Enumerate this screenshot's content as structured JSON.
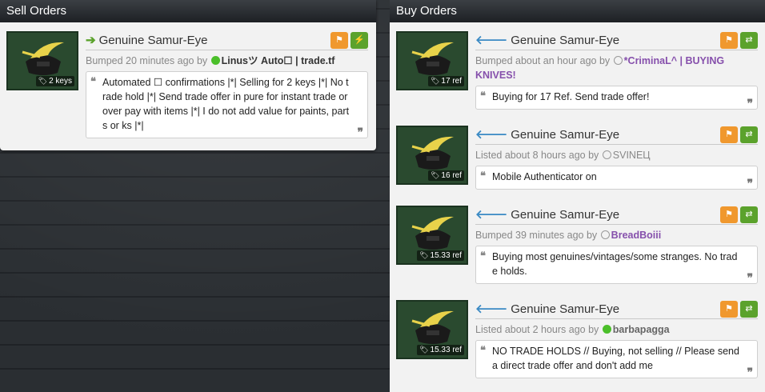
{
  "sell": {
    "header": "Sell Orders",
    "orders": [
      {
        "item_name": "Genuine Samur-Eye",
        "price": "2 keys",
        "status": "Bumped 20 minutes ago by",
        "user": "Linusツ Auto☐ | trade.tf",
        "comment": "Automated ☐ confirmations |*| Selling for 2 keys |*| No trade hold |*| Send trade offer in pure for instant trade or over pay with items |*| I do not add value for paints, parts or ks |*|"
      }
    ]
  },
  "buy": {
    "header": "Buy Orders",
    "orders": [
      {
        "item_name": "Genuine Samur-Eye",
        "price": "17 ref",
        "status": "Bumped about an hour ago by",
        "user": "*CriminaL^ | BUYING KNIVES!",
        "comment": "Buying for 17 Ref. Send trade offer!"
      },
      {
        "item_name": "Genuine Samur-Eye",
        "price": "16 ref",
        "status": "Listed about 8 hours ago by",
        "user": "SVINЕЦ",
        "comment": "Mobile Authenticator on"
      },
      {
        "item_name": "Genuine Samur-Eye",
        "price": "15.33 ref",
        "status": "Bumped 39 minutes ago by",
        "user": "BreadBoiii",
        "comment": "Buying most genuines/vintages/some stranges. No trade holds."
      },
      {
        "item_name": "Genuine Samur-Eye",
        "price": "15.33 ref",
        "status": "Listed about 2 hours ago by",
        "user": "barbapagga",
        "comment": "NO TRADE HOLDS // Buying, not selling // Please send a direct trade offer and don't add me"
      }
    ]
  },
  "icons": {
    "sell_arrow": "arrow-right-icon",
    "buy_arrow": "arrow-left-icon",
    "report": "flag-icon",
    "instant": "lightning-icon",
    "trade": "exchange-icon",
    "price": "tag-icon",
    "quote_open": "quote-open-icon",
    "quote_close": "quote-close-icon"
  },
  "colors": {
    "sell_arrow": "#5ba22c",
    "buy_arrow": "#3b8ac4",
    "flag_button": "#f0982e",
    "action_button": "#5ba22c",
    "online": "#4bbf2a",
    "premium_user": "#8650ac",
    "item_bg": "#2a4a2f"
  }
}
